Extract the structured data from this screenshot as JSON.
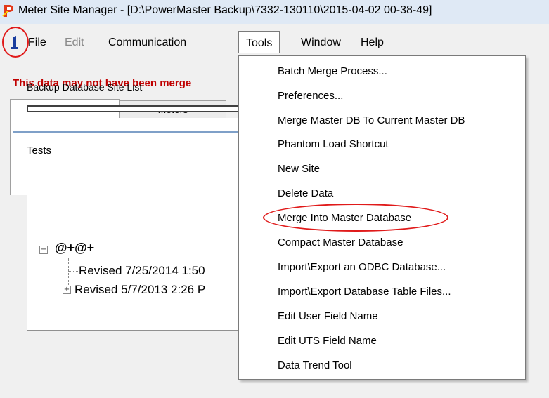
{
  "window": {
    "title": "Meter Site Manager - [D:\\PowerMaster Backup\\7332-130110\\2015-04-02 00-38-49]"
  },
  "menubar": {
    "items": [
      {
        "label": "File",
        "enabled": true
      },
      {
        "label": "Edit",
        "enabled": false
      },
      {
        "label": "Communication",
        "enabled": true
      },
      {
        "label": "Tools",
        "enabled": true,
        "open": true
      },
      {
        "label": "Window",
        "enabled": true
      },
      {
        "label": "Help",
        "enabled": true
      }
    ]
  },
  "main": {
    "warning": "This data may not have been merge",
    "tabs": [
      {
        "label": "Sites",
        "active": true
      },
      {
        "label": "Meters",
        "active": false
      }
    ],
    "backup_label": "Backup Database Site List",
    "tests_label": "Tests",
    "tree": {
      "root": "@+@+",
      "children": [
        "Revised 7/25/2014 1:50",
        "Revised 5/7/2013 2:26 P"
      ]
    }
  },
  "tools_menu": {
    "items": [
      "Batch Merge Process...",
      "Preferences...",
      "Merge Master DB To Current Master DB",
      "Phantom Load Shortcut",
      "New Site",
      "Delete Data",
      "Merge Into Master Database",
      "Compact Master Database",
      "Import\\Export an ODBC Database...",
      "Import\\Export Database Table Files...",
      "Edit User Field Name",
      "Edit UTS Field Name",
      "Data Trend Tool"
    ],
    "highlighted_item": "Merge Into Master Database"
  },
  "colors": {
    "annotation": "#e01a1a",
    "warning_text": "#c00000",
    "titlebar": "#dfe9f5"
  }
}
